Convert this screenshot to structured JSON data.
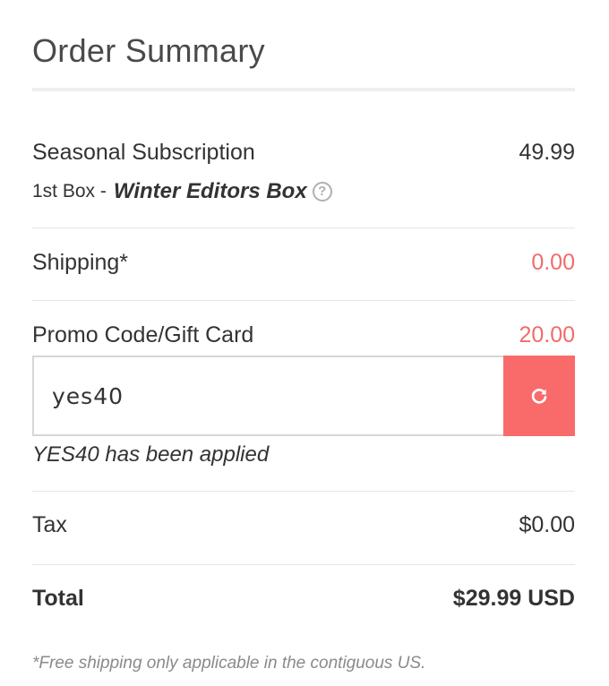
{
  "order_summary": {
    "title": "Order Summary",
    "subscription": {
      "label": "Seasonal Subscription",
      "amount": "49.99",
      "box_prefix": "1st Box -",
      "box_name": "Winter Editors Box",
      "help_icon": "question-circle-icon"
    },
    "shipping": {
      "label": "Shipping*",
      "amount": "0.00"
    },
    "promo": {
      "label": "Promo Code/Gift Card",
      "amount": "20.00",
      "input_value": "yes40",
      "button_icon": "refresh-icon",
      "applied_message": "YES40 has been applied"
    },
    "tax": {
      "label": "Tax",
      "amount": "$0.00"
    },
    "total": {
      "label": "Total",
      "amount": "$29.99 USD"
    },
    "footnote": "*Free shipping only applicable in the contiguous US."
  },
  "colors": {
    "accent": "#f96b6b",
    "discount_text": "#f26b6b",
    "text": "#333333",
    "muted": "#8a8a8a",
    "divider": "#e6e6e6"
  }
}
